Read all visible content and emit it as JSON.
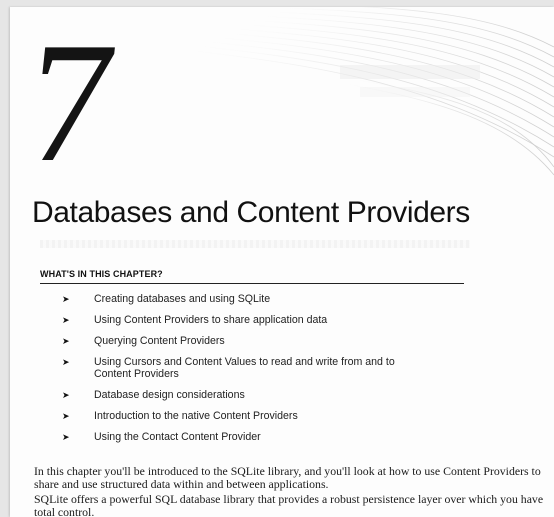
{
  "chapter": {
    "number": "7",
    "title": "Databases and Content Providers"
  },
  "section": {
    "heading": "WHAT'S IN THIS CHAPTER?",
    "bullet_symbol": "➤",
    "items": [
      "Creating databases and using SQLite",
      "Using Content Providers to share application data",
      "Querying Content Providers",
      "Using Cursors and Content Values to read and write from and to Content Providers",
      "Database design considerations",
      "Introduction to the native Content Providers",
      "Using the Contact Content Provider"
    ]
  },
  "body": {
    "paragraph_1": "In this chapter you'll be introduced to the SQLite library, and you'll look at how to use Content Providers to share and use structured data within and between applications.",
    "paragraph_2": "SQLite offers a powerful SQL database library that provides a robust persistence layer over which you have total control."
  }
}
